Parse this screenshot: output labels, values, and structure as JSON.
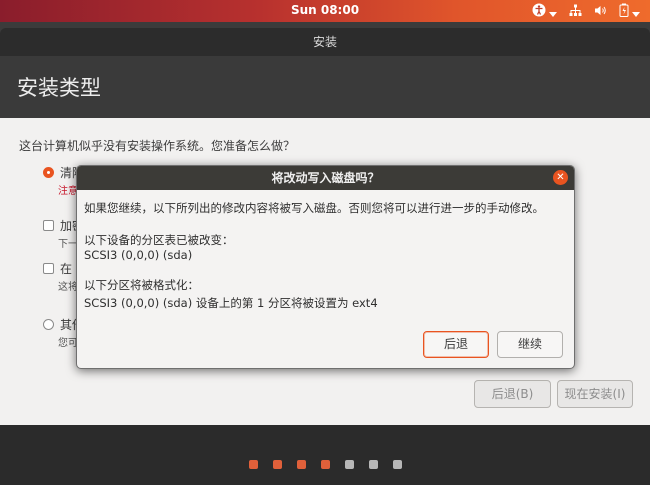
{
  "topbar": {
    "clock": "Sun 08:00",
    "icons": [
      "accessibility-icon",
      "network-icon",
      "volume-icon",
      "battery-icon"
    ]
  },
  "window": {
    "title": "安装",
    "heading": "安装类型",
    "question": "这台计算机似乎没有安装操作系统。您准备怎么做？",
    "options": [
      {
        "label": "清除",
        "sub": "注意",
        "selected": true,
        "kind": "radio"
      },
      {
        "label": "加密",
        "sub": "下一",
        "selected": false,
        "kind": "checkbox"
      },
      {
        "label": "在 L",
        "sub": "这将",
        "selected": false,
        "kind": "checkbox"
      },
      {
        "label": "其他",
        "sub": "您可",
        "selected": false,
        "kind": "radio"
      }
    ],
    "back_button": "后退(B)",
    "install_button": "现在安装(I)"
  },
  "dialog": {
    "title": "将改动写入磁盘吗？",
    "intro": "如果您继续，以下所列出的修改内容将被写入磁盘。否则您将可以进行进一步的手动修改。",
    "partition_table_heading": "以下设备的分区表已被改变：",
    "partition_table_device": "SCSI3 (0,0,0) (sda)",
    "format_heading": "以下分区将被格式化：",
    "format_item": "SCSI3 (0,0,0) (sda) 设备上的第 1 分区将被设置为 ext4",
    "back_button": "后退",
    "continue_button": "继续",
    "close_icon": "close-icon"
  },
  "progress": {
    "total_steps": 7,
    "completed_steps": 4
  },
  "colors": {
    "accent": "#e95420",
    "warning_text": "#c7162b"
  }
}
